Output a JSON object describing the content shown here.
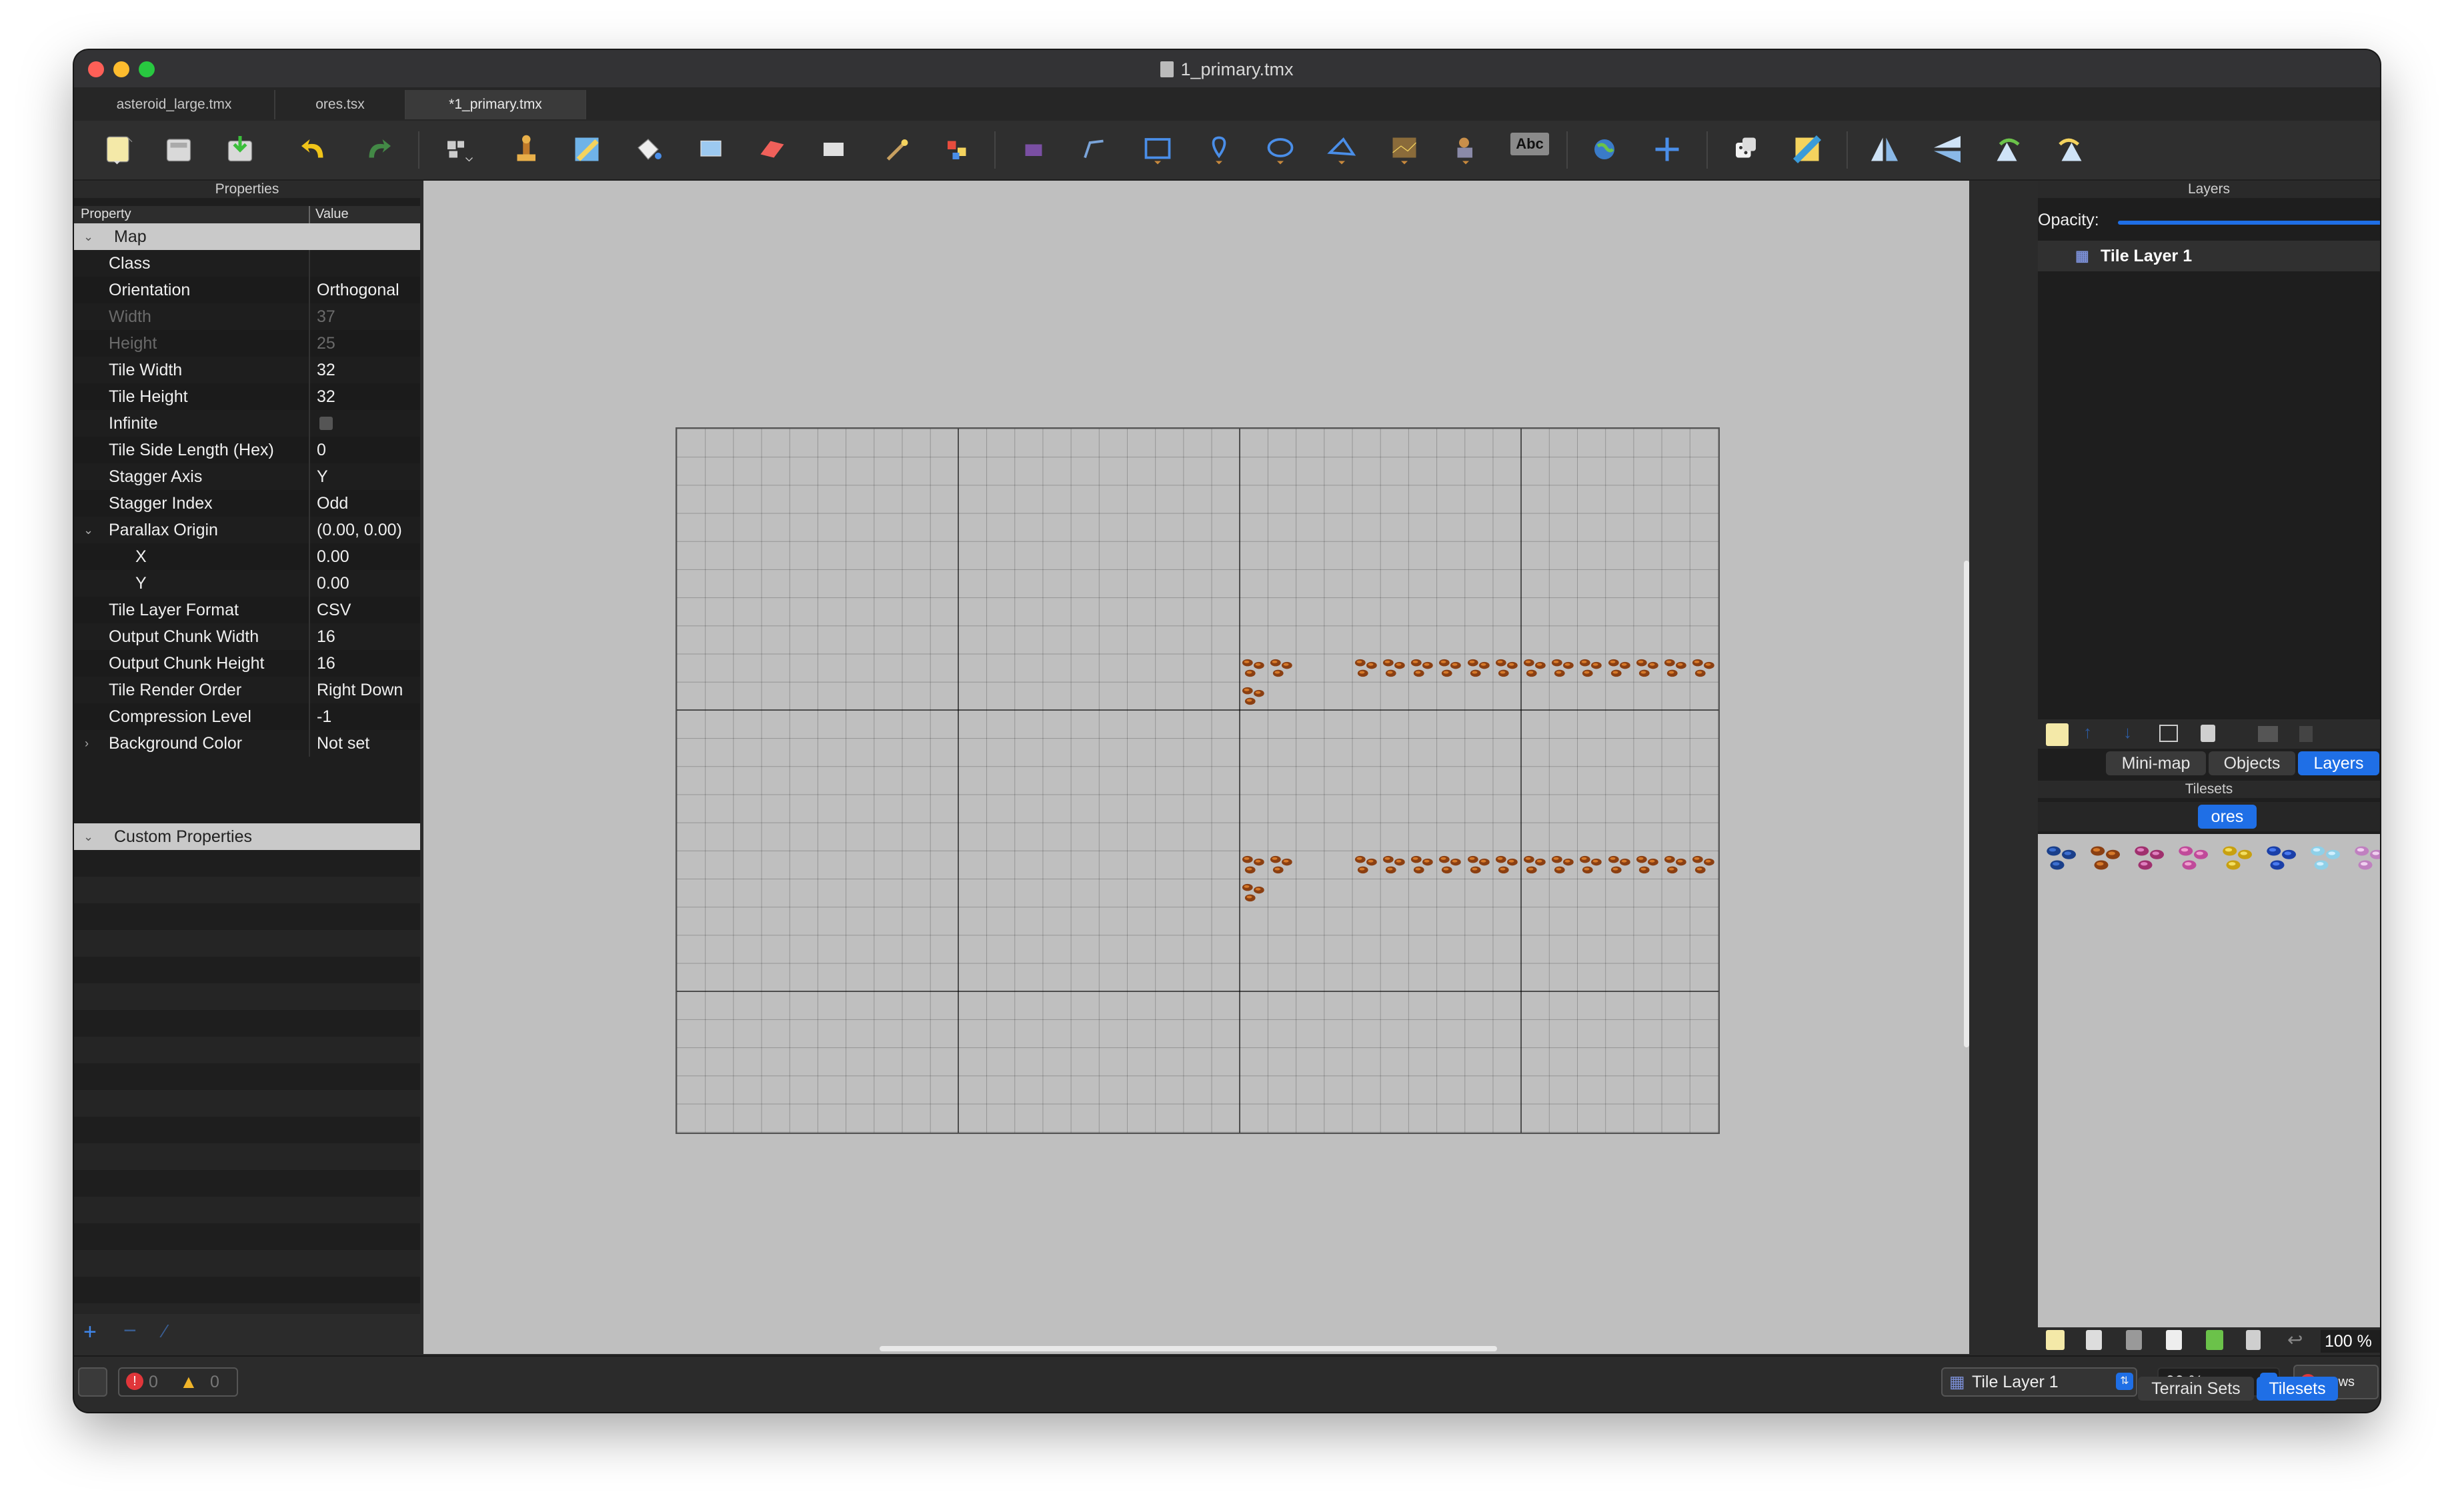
{
  "window": {
    "title": "1_primary.tmx"
  },
  "tabs": [
    {
      "label": "asteroid_large.tmx"
    },
    {
      "label": "ores.tsx"
    },
    {
      "label": "*1_primary.tmx"
    }
  ],
  "toolbar": {
    "icons": [
      "new-map-icon",
      "open-icon",
      "save-icon",
      "undo-icon",
      "redo-icon",
      "world-tool-icon",
      "stamp-brush-icon",
      "terrain-brush-icon",
      "bucket-fill-icon",
      "shape-fill-icon",
      "eraser-icon",
      "rect-select-icon",
      "magic-wand-icon",
      "select-same-tile-icon",
      "select-objects-icon",
      "edit-polygons-icon",
      "insert-rectangle-icon",
      "insert-point-icon",
      "insert-ellipse-icon",
      "insert-polygon-icon",
      "insert-tile-icon",
      "insert-template-icon",
      "insert-text-icon",
      "world-icon",
      "move-icon",
      "random-mode-icon",
      "wang-fill-icon",
      "flip-horizontal-icon",
      "flip-vertical-icon",
      "rotate-left-icon",
      "rotate-right-icon"
    ],
    "text_tool_label": "Abc"
  },
  "properties": {
    "panel_title": "Properties",
    "col_property": "Property",
    "col_value": "Value",
    "group_map": "Map",
    "group_custom": "Custom Properties",
    "rows": [
      {
        "key": "Class",
        "value": ""
      },
      {
        "key": "Orientation",
        "value": "Orthogonal"
      },
      {
        "key": "Width",
        "value": "37"
      },
      {
        "key": "Height",
        "value": "25"
      },
      {
        "key": "Tile Width",
        "value": "32"
      },
      {
        "key": "Tile Height",
        "value": "32"
      },
      {
        "key": "Infinite",
        "value": ""
      },
      {
        "key": "Tile Side Length (Hex)",
        "value": "0"
      },
      {
        "key": "Stagger Axis",
        "value": "Y"
      },
      {
        "key": "Stagger Index",
        "value": "Odd"
      },
      {
        "key": "Parallax Origin",
        "value": "(0.00, 0.00)"
      },
      {
        "key": "X",
        "value": "0.00"
      },
      {
        "key": "Y",
        "value": "0.00"
      },
      {
        "key": "Tile Layer Format",
        "value": "CSV"
      },
      {
        "key": "Output Chunk Width",
        "value": "16"
      },
      {
        "key": "Output Chunk Height",
        "value": "16"
      },
      {
        "key": "Tile Render Order",
        "value": "Right Down"
      },
      {
        "key": "Compression Level",
        "value": "-1"
      },
      {
        "key": "Background Color",
        "value": "Not set"
      }
    ]
  },
  "layers": {
    "panel_title": "Layers",
    "opacity_label": "Opacity:",
    "opacity": 1.0,
    "items": [
      {
        "name": "Tile Layer 1"
      }
    ],
    "tabs": [
      "Mini-map",
      "Objects",
      "Layers"
    ],
    "active_tab": "Layers"
  },
  "tilesets": {
    "panel_title": "Tilesets",
    "active": "ores",
    "zoom": "100 %",
    "tabs": [
      "Terrain Sets",
      "Tilesets"
    ],
    "active_tab": "Tilesets"
  },
  "status": {
    "errors": "0",
    "warnings": "0",
    "current_layer": "Tile Layer 1",
    "zoom": "66 %",
    "news_label": "News"
  },
  "colors": {
    "accent": "#1f6fe6",
    "canvas_bg": "#bfbfbf",
    "ore_brown": "#8a3f12",
    "ore_highlight": "#d77a2a"
  }
}
